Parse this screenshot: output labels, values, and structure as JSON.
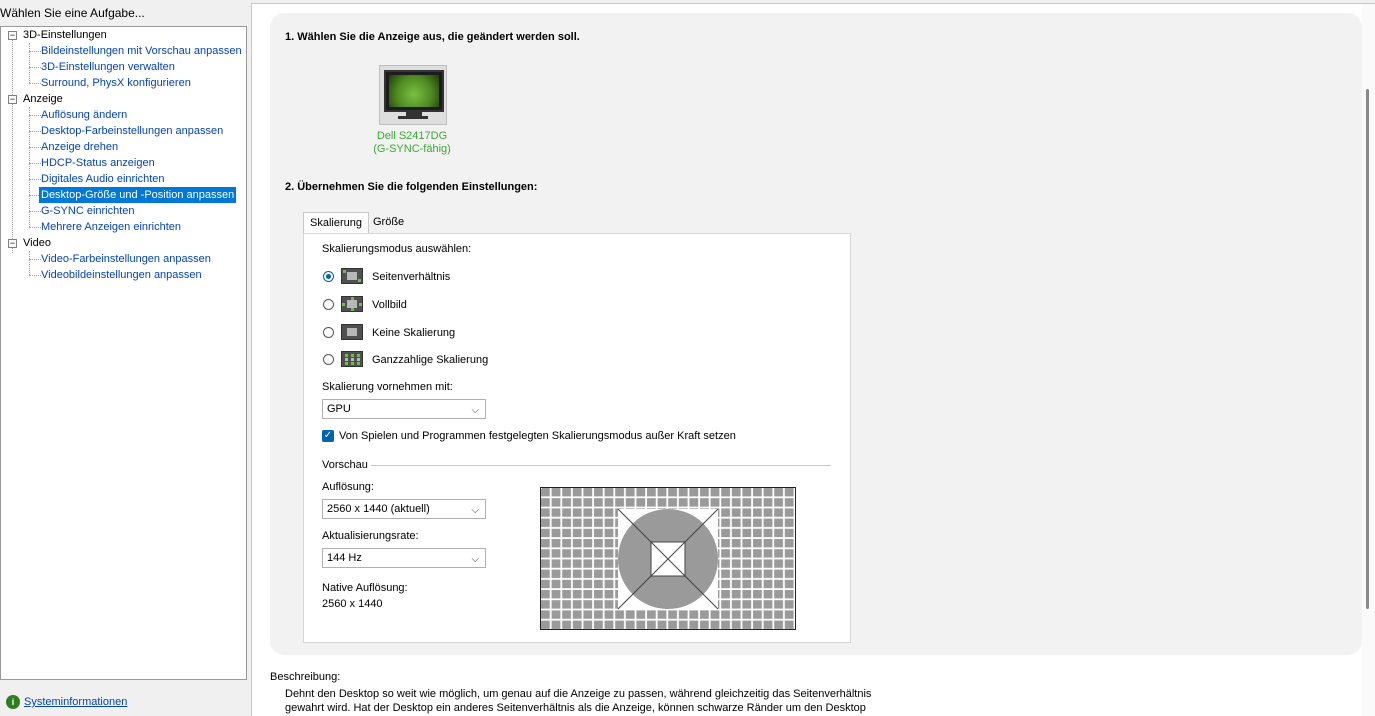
{
  "left": {
    "header": "Wählen Sie eine Aufgabe...",
    "tree": [
      {
        "label": "3D-Einstellungen",
        "expander": "-",
        "children": [
          {
            "label": "Bildeinstellungen mit Vorschau anpassen"
          },
          {
            "label": "3D-Einstellungen verwalten"
          },
          {
            "label": "Surround, PhysX konfigurieren"
          }
        ]
      },
      {
        "label": "Anzeige",
        "expander": "-",
        "children": [
          {
            "label": "Auflösung ändern"
          },
          {
            "label": "Desktop-Farbeinstellungen anpassen"
          },
          {
            "label": "Anzeige drehen"
          },
          {
            "label": "HDCP-Status anzeigen"
          },
          {
            "label": "Digitales Audio einrichten"
          },
          {
            "label": "Desktop-Größe und -Position anpassen",
            "selected": true
          },
          {
            "label": "G-SYNC einrichten"
          },
          {
            "label": "Mehrere Anzeigen einrichten"
          }
        ]
      },
      {
        "label": "Video",
        "expander": "-",
        "children": [
          {
            "label": "Video-Farbeinstellungen anpassen"
          },
          {
            "label": "Videobildeinstellungen anpassen"
          }
        ]
      }
    ],
    "sysinfo": {
      "label": "Systeminformationen",
      "icon": "info-icon"
    }
  },
  "main": {
    "section1": "1. Wählen Sie die Anzeige aus, die geändert werden soll.",
    "monitor": {
      "name_line1": "Dell S2417DG",
      "name_line2": "(G-SYNC-fähig)",
      "icon": "monitor-icon"
    },
    "section2": "2. Übernehmen Sie die folgenden Einstellungen:",
    "tabs": [
      {
        "label": "Skalierung",
        "active": true
      },
      {
        "label": "Größe"
      }
    ],
    "scaling_mode_label": "Skalierungsmodus auswählen:",
    "modes": [
      {
        "label": "Seitenverhältnis",
        "checked": true
      },
      {
        "label": "Vollbild",
        "checked": false
      },
      {
        "label": "Keine Skalierung",
        "checked": false
      },
      {
        "label": "Ganzzahlige Skalierung",
        "checked": false
      }
    ],
    "perform_label": "Skalierung vornehmen mit:",
    "perform_value": "GPU",
    "override_label": "Von Spielen und Programmen festgelegten Skalierungsmodus außer Kraft setzen",
    "override_checked": true,
    "preview_label": "Vorschau",
    "resolution_label": "Auflösung:",
    "resolution_value": "2560 x 1440 (aktuell)",
    "refresh_label": "Aktualisierungsrate:",
    "refresh_value": "144 Hz",
    "native_label": "Native Auflösung:",
    "native_value": "2560 x 1440",
    "desc_label": "Beschreibung:",
    "desc_text": "Dehnt den Desktop so weit wie möglich, um genau auf die Anzeige zu passen, während gleichzeitig das Seitenverhältnis gewahrt wird. Hat der Desktop ein anderes Seitenverhältnis als die Anzeige, können schwarze Ränder um den Desktop"
  },
  "colors": {
    "accent": "#0078d7",
    "nvidia_green": "#3aa836",
    "link": "#0645ad"
  }
}
